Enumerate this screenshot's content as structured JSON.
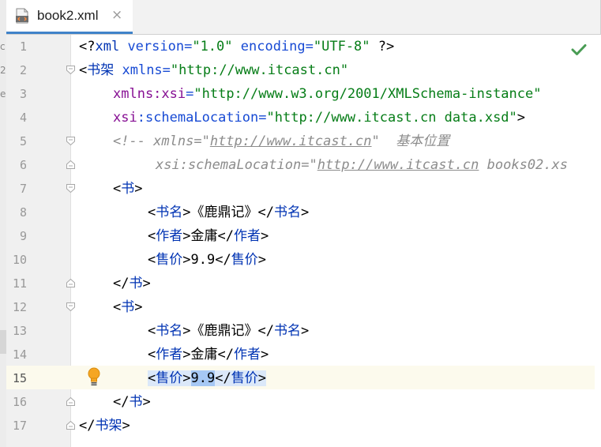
{
  "tab": {
    "title": "book2.xml",
    "close_glyph": "×",
    "icon": "xml-file-icon"
  },
  "left_strip": {
    "chars": [
      "c",
      "2",
      "e"
    ]
  },
  "status": {
    "icon": "checkmark-icon",
    "color": "#499c54"
  },
  "current_line": 15,
  "line_numbers": [
    "1",
    "2",
    "3",
    "4",
    "5",
    "6",
    "7",
    "8",
    "9",
    "10",
    "11",
    "12",
    "13",
    "14",
    "15",
    "16",
    "17"
  ],
  "code": {
    "l1": {
      "open": "<?",
      "name": "xml",
      "a1": " version=",
      "v1": "\"1.0\"",
      "a2": " encoding=",
      "v2": "\"UTF-8\"",
      "close": " ?>"
    },
    "l2": {
      "lt": "<",
      "tag": "书架",
      "attr": " xmlns=",
      "val": "\"http://www.itcast.cn\""
    },
    "l3": {
      "ns": "xmlns:xsi",
      "eq": "=",
      "val": "\"http://www.w3.org/2001/XMLSchema-instance\""
    },
    "l4": {
      "ns": "xsi",
      "attr": ":schemaLocation",
      "eq": "=",
      "val": "\"http://www.itcast.cn data.xsd\"",
      "gt": ">"
    },
    "l5": {
      "start": "<!-- xmlns=\"",
      "url": "http://www.itcast.cn",
      "end": "\"  基本位置"
    },
    "l6": {
      "start": "xsi:schemaLocation=\"",
      "url": "http://www.itcast.cn",
      "end": " books02.xs"
    },
    "l7": {
      "lt": "<",
      "tag": "书",
      "gt": ">"
    },
    "l8": {
      "o1": "<",
      "t1": "书名",
      "o2": ">",
      "text": "《鹿鼎记》",
      "c1": "</",
      "t2": "书名",
      "c2": ">"
    },
    "l9": {
      "o1": "<",
      "t1": "作者",
      "o2": ">",
      "text": "金庸",
      "c1": "</",
      "t2": "作者",
      "c2": ">"
    },
    "l10": {
      "o1": "<",
      "t1": "售价",
      "o2": ">",
      "text": "9.9",
      "c1": "</",
      "t2": "售价",
      "c2": ">"
    },
    "l11": {
      "lt": "</",
      "tag": "书",
      "gt": ">"
    },
    "l12": {
      "lt": "<",
      "tag": "书",
      "gt": ">"
    },
    "l13": {
      "o1": "<",
      "t1": "书名",
      "o2": ">",
      "text": "《鹿鼎记》",
      "c1": "</",
      "t2": "书名",
      "c2": ">"
    },
    "l14": {
      "o1": "<",
      "t1": "作者",
      "o2": ">",
      "text": "金庸",
      "c1": "</",
      "t2": "作者",
      "c2": ">"
    },
    "l15": {
      "o1": "<",
      "t1": "售价",
      "o2": ">",
      "text": "9.9",
      "c1": "</",
      "t2": "售价",
      "c2": ">"
    },
    "l16": {
      "lt": "</",
      "tag": "书",
      "gt": ">"
    },
    "l17": {
      "lt": "</",
      "tag": "书架",
      "gt": ">"
    }
  }
}
